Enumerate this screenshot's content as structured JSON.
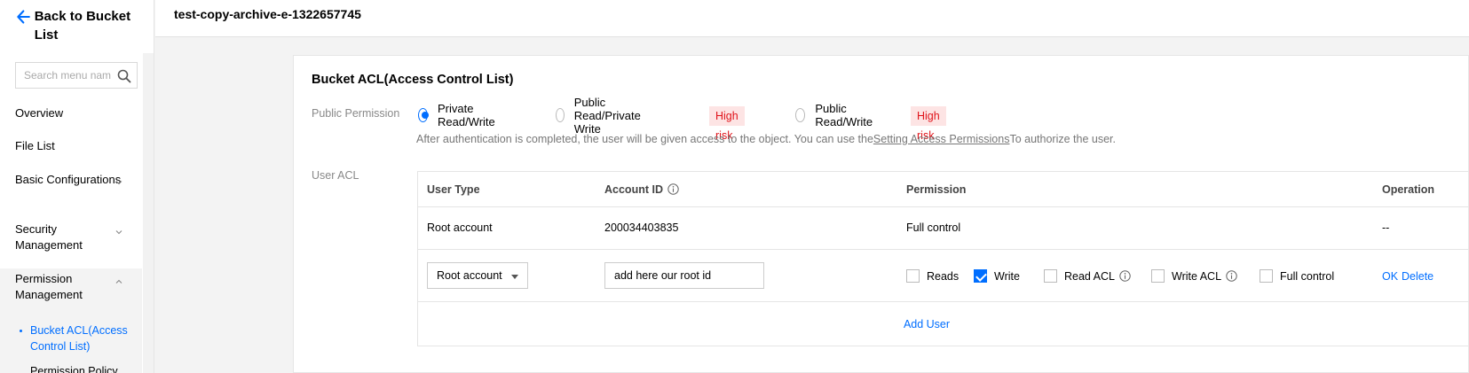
{
  "sidebar": {
    "back_label": "Back to Bucket List",
    "search_placeholder": "Search menu nam",
    "items": [
      {
        "label": "Overview"
      },
      {
        "label": "File List"
      },
      {
        "label": "Basic Configurations"
      },
      {
        "label": "Security Management"
      },
      {
        "label": "Permission Management"
      }
    ],
    "sub_items": [
      {
        "label": "Bucket ACL(Access Control List)"
      },
      {
        "label": "Permission Policy"
      }
    ]
  },
  "header": {
    "title": "test-copy-archive-e-1322657745"
  },
  "card": {
    "title": "Bucket ACL(Access Control List)",
    "public_permission_label": "Public Permission",
    "options": [
      {
        "label": "Private Read/Write",
        "selected": true
      },
      {
        "label": "Public Read/Private Write",
        "badge": "High risk"
      },
      {
        "label": "Public Read/Write",
        "badge": "High risk"
      }
    ],
    "hint_prefix": "After authentication is completed, the user will be given access to the object. You can use the",
    "hint_link": "Setting Access Permissions",
    "hint_suffix": "To authorize the user.",
    "user_acl_label": "User ACL"
  },
  "table": {
    "headers": {
      "user_type": "User Type",
      "account_id": "Account ID",
      "permission": "Permission",
      "operation": "Operation"
    },
    "row1": {
      "user_type": "Root account",
      "account_id": "200034403835",
      "permission": "Full control",
      "operation": "--"
    },
    "edit_row": {
      "user_type_value": "Root account",
      "account_id_value": "add here our root id",
      "checkboxes": [
        {
          "label": "Reads",
          "checked": false
        },
        {
          "label": "Write",
          "checked": true
        },
        {
          "label": "Read ACL",
          "checked": false
        },
        {
          "label": "Write ACL",
          "checked": false
        },
        {
          "label": "Full control",
          "checked": false
        }
      ],
      "ok_label": "OK",
      "delete_label": "Delete"
    },
    "add_user_label": "Add User"
  },
  "colors": {
    "accent": "#006eff",
    "risk_bg": "#fde4e4",
    "risk_text": "#e0141b"
  }
}
